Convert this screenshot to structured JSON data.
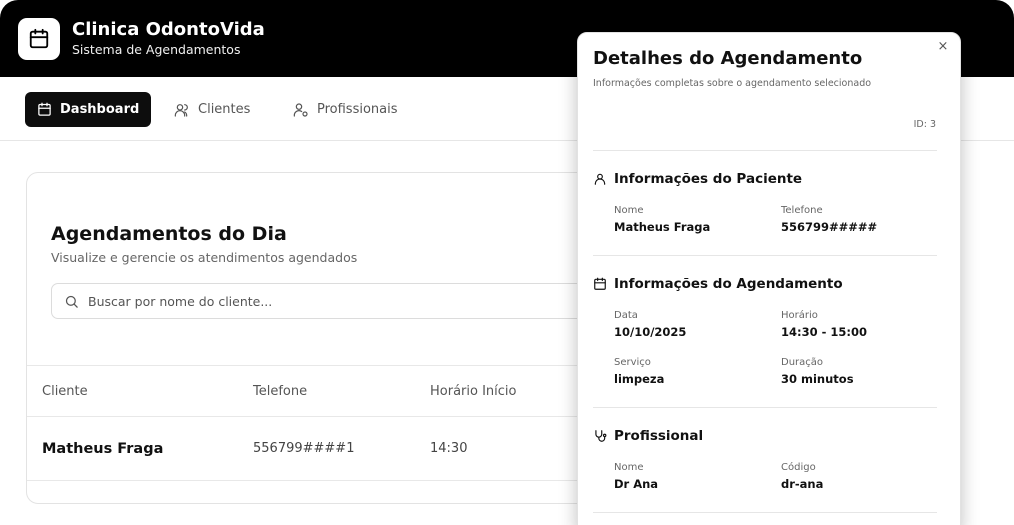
{
  "header": {
    "title": "Clinica OdontoVida",
    "subtitle": "Sistema de Agendamentos"
  },
  "nav": {
    "items": [
      {
        "label": "Dashboard",
        "icon": "calendar-icon",
        "active": true
      },
      {
        "label": "Clientes",
        "icon": "users-icon",
        "active": false
      },
      {
        "label": "Profissionais",
        "icon": "user-gear-icon",
        "active": false
      }
    ]
  },
  "main": {
    "title": "Agendamentos do Dia",
    "subtitle": "Visualize e gerencie os atendimentos agendados",
    "search_placeholder": "Buscar por nome do cliente...",
    "table": {
      "headers": [
        "Cliente",
        "Telefone",
        "Horário Início"
      ],
      "rows": [
        {
          "cliente": "Matheus Fraga",
          "telefone": "556799####1",
          "horario": "14:30"
        }
      ]
    }
  },
  "dialog": {
    "title": "Detalhes do Agendamento",
    "subtitle": "Informações completas sobre o agendamento selecionado",
    "id_label": "ID: 3",
    "close_label": "×",
    "paciente": {
      "title": "Informações do Paciente",
      "nome_label": "Nome",
      "nome_value": "Matheus Fraga",
      "telefone_label": "Telefone",
      "telefone_value": "556799#####"
    },
    "agendamento": {
      "title": "Informações do Agendamento",
      "data_label": "Data",
      "data_value": "10/10/2025",
      "horario_label": "Horário",
      "horario_value": "14:30 - 15:00",
      "servico_label": "Serviço",
      "servico_value": "limpeza",
      "duracao_label": "Duração",
      "duracao_value": "30 minutos"
    },
    "profissional": {
      "title": "Profissional",
      "nome_label": "Nome",
      "nome_value": "Dr Ana",
      "codigo_label": "Código",
      "codigo_value": "dr-ana"
    }
  },
  "colors": {
    "header_bg": "#000000",
    "active_nav_bg": "#0d0d0d",
    "border": "#e3e3e3",
    "muted_text": "#666666"
  }
}
